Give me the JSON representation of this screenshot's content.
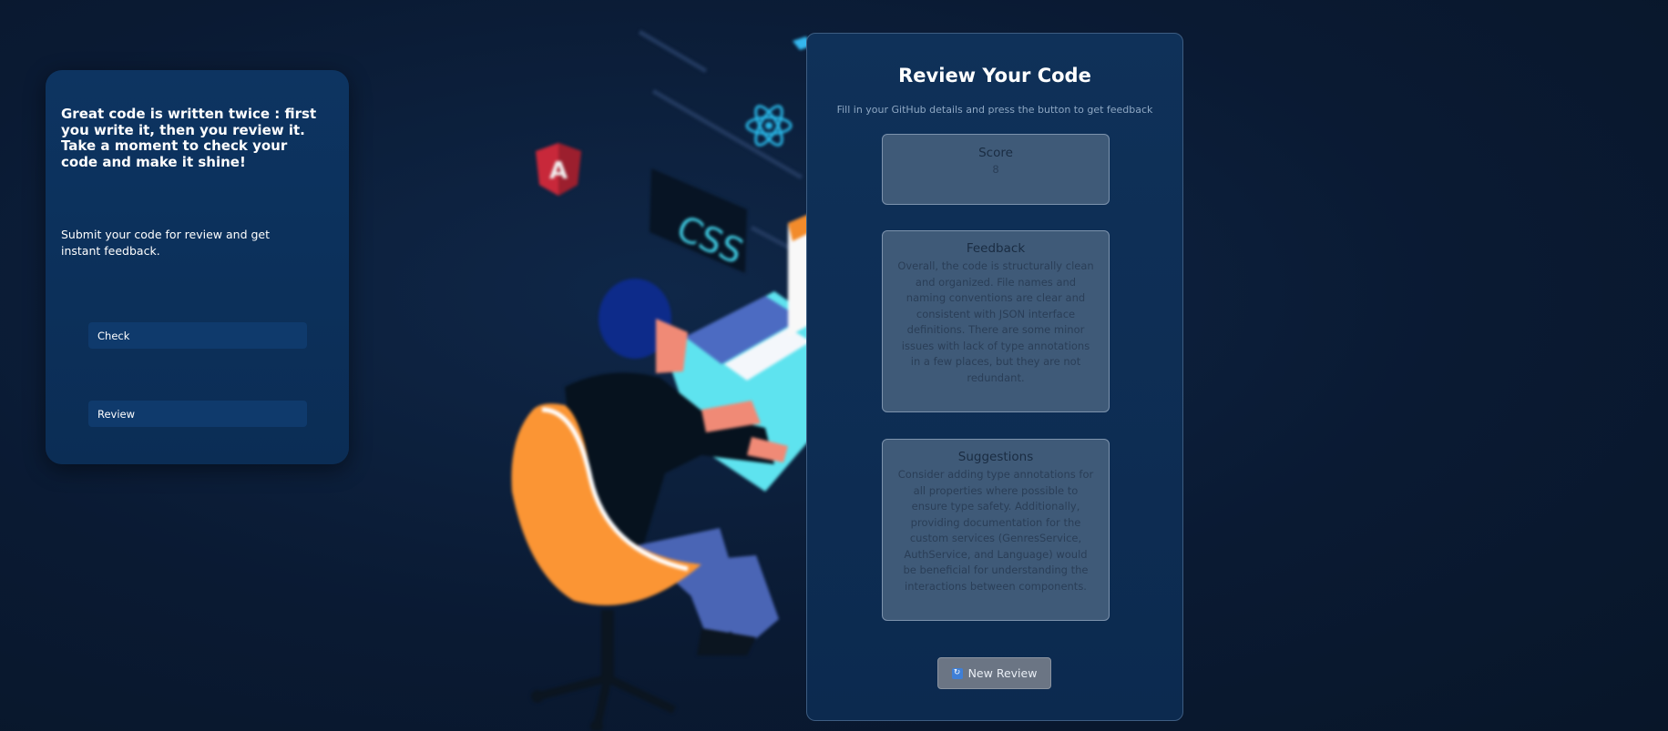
{
  "left_card": {
    "heading": "Great code is written twice : first you write it, then you review it. Take a moment to check your code and make it shine!",
    "subtext": "Submit your code for review and get instant feedback.",
    "check_label": "Check",
    "review_label": "Review"
  },
  "panel": {
    "title": "Review Your Code",
    "subtitle": "Fill in your GitHub details and press the button to get feedback",
    "score": {
      "label": "Score",
      "value": "8"
    },
    "feedback": {
      "label": "Feedback",
      "text": "Overall, the code is structurally clean and organized. File names and naming conventions are clear and consistent with JSON interface definitions. There are some minor issues with lack of type annotations in a few places, but they are not redundant."
    },
    "suggestions": {
      "label": "Suggestions",
      "text": "Consider adding type annotations for all properties where possible to ensure type safety. Additionally, providing documentation for the custom services (GenresService, AuthService, and Language) would be beneficial for understanding the interactions between components."
    },
    "new_review_label": "New Review",
    "new_review_icon": "refresh-icon"
  },
  "illustration": {
    "badge_text": "A",
    "css_label": "CSS"
  },
  "colors": {
    "background": "#0a1a33",
    "card": "#0d3461",
    "panel": "#0f3159",
    "result_box": "#3f5a78",
    "button": "#6b7584"
  }
}
